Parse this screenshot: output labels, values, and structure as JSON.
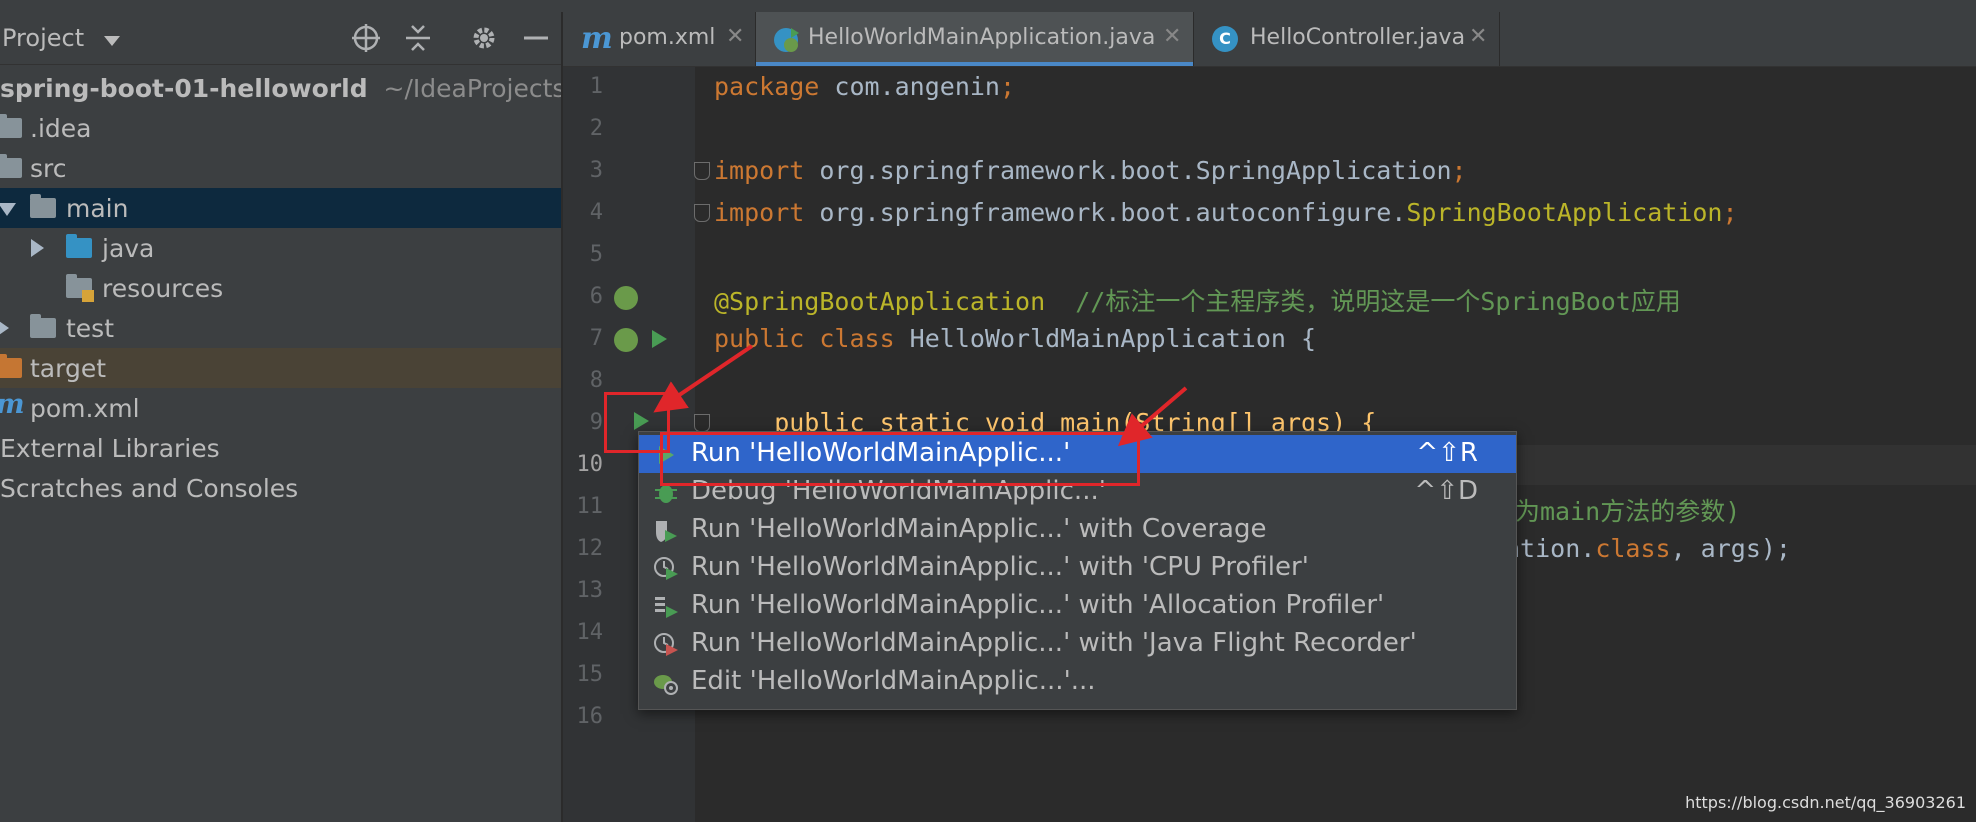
{
  "project_panel": {
    "title": "Project",
    "tree": [
      {
        "label": "spring-boot-01-helloworld",
        "suffix": "~/IdeaProjects/"
      },
      {
        "label": ".idea"
      },
      {
        "label": "src"
      },
      {
        "label": "main"
      },
      {
        "label": "java"
      },
      {
        "label": "resources"
      },
      {
        "label": "test"
      },
      {
        "label": "target"
      },
      {
        "label": "pom.xml"
      },
      {
        "label": "External Libraries"
      },
      {
        "label": "Scratches and Consoles"
      }
    ]
  },
  "tabs": [
    {
      "label": "pom.xml",
      "icon": "maven-icon"
    },
    {
      "label": "HelloWorldMainApplication.java",
      "icon": "spring-class-icon"
    },
    {
      "label": "HelloController.java",
      "icon": "class-icon"
    }
  ],
  "editor": {
    "line_numbers": [
      "1",
      "2",
      "3",
      "4",
      "5",
      "6",
      "7",
      "8",
      "9",
      "10",
      "11",
      "12",
      "13",
      "14",
      "15",
      "16"
    ],
    "current_line": "10",
    "code": {
      "l1_kw": "package",
      "l1_rest": " com.angenin",
      "l1_semi": ";",
      "l3_kw": "import",
      "l3_rest": " org.springframework.boot.SpringApplication",
      "l3_semi": ";",
      "l4_kw": "import",
      "l4_rest": " org.springframework.boot.autoconfigure.",
      "l4_ann": "SpringBootApplication",
      "l4_semi": ";",
      "l6_ann": "@SpringBootApplication",
      "l6_com": "  //标注一个主程序类，说明这是一个SpringBoot应用",
      "l7_kw": "public class",
      "l7_rest": " HelloWorldMainApplication {",
      "l9_text": "    public static void main(String[] args) {",
      "l11_com": "为main方法的参数)",
      "l12_rest": "ation.",
      "l12_kw": "class",
      "l12_tail": ", args);"
    }
  },
  "popup": {
    "items": [
      {
        "label": "Run 'HelloWorldMainApplic...'",
        "shortcut": "^⇧R",
        "icon": "run-icon"
      },
      {
        "label": "Debug 'HelloWorldMainApplic...'",
        "shortcut": "^⇧D",
        "icon": "debug-icon"
      },
      {
        "label": "Run 'HelloWorldMainApplic...' with Coverage",
        "icon": "coverage-icon"
      },
      {
        "label": "Run 'HelloWorldMainApplic...' with 'CPU Profiler'",
        "icon": "cpu-profiler-icon"
      },
      {
        "label": "Run 'HelloWorldMainApplic...' with 'Allocation Profiler'",
        "icon": "allocation-profiler-icon"
      },
      {
        "label": "Run 'HelloWorldMainApplic...' with 'Java Flight Recorder'",
        "icon": "flight-recorder-icon"
      },
      {
        "label": "Edit 'HelloWorldMainApplic...'...",
        "icon": "edit-config-icon"
      }
    ]
  },
  "watermark": "https://blog.csdn.net/qq_36903261",
  "colors": {
    "accent": "#2f65ca",
    "annotation_red": "#e0262a",
    "run_green": "#499c54"
  }
}
